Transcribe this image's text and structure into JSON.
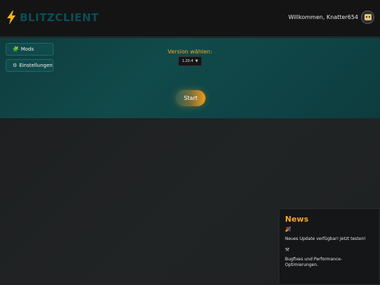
{
  "header": {
    "app_name": "BLITZCLIENT",
    "logo_icon": "lightning-bolt-icon",
    "welcome_text": "Willkommen, Knatter654",
    "avatar_icon": "avatar-icon"
  },
  "sidebar": {
    "items": [
      {
        "label": "Mods",
        "icon": "puzzle-icon"
      },
      {
        "label": "Einstellungen",
        "icon": "gear-icon"
      }
    ]
  },
  "launcher": {
    "version_label": "Version wählen:",
    "version_selected": "1.20.4",
    "start_label": "Start"
  },
  "news": {
    "title": "News",
    "items": [
      {
        "icon": "party-popper-icon",
        "text": "Neues Update verfügbar! Jetzt testen!"
      },
      {
        "icon": "tools-icon",
        "text": "Bugfixes und Performance-Optimierungen."
      }
    ]
  },
  "colors": {
    "accent": "#f1a52a",
    "teal": "#114a4a",
    "logo_text": "#0a4e57",
    "background": "#1b1d1f"
  }
}
